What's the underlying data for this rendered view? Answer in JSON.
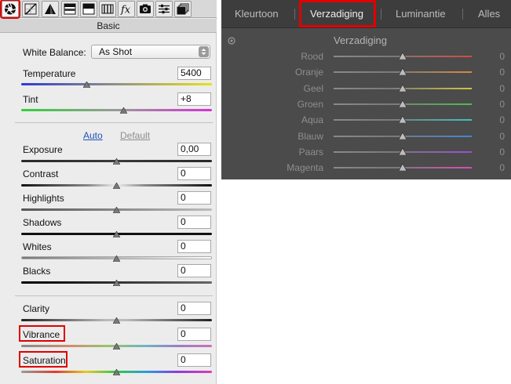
{
  "basic_panel": {
    "header": "Basic",
    "white_balance": {
      "label": "White Balance:",
      "value": "As Shot"
    },
    "temperature": {
      "label": "Temperature",
      "value": "5400"
    },
    "tint": {
      "label": "Tint",
      "value": "+8"
    },
    "auto_link": "Auto",
    "default_link": "Default",
    "sliders": [
      {
        "label": "Exposure",
        "value": "0,00"
      },
      {
        "label": "Contrast",
        "value": "0"
      },
      {
        "label": "Highlights",
        "value": "0"
      },
      {
        "label": "Shadows",
        "value": "0"
      },
      {
        "label": "Whites",
        "value": "0"
      },
      {
        "label": "Blacks",
        "value": "0"
      }
    ],
    "presence": [
      {
        "label": "Clarity",
        "value": "0"
      },
      {
        "label": "Vibrance",
        "value": "0"
      },
      {
        "label": "Saturation",
        "value": "0"
      }
    ],
    "toolbar_icons": [
      "basic-aperture-icon",
      "tone-curve-icon",
      "detail-triangle-icon",
      "hsl-grayscale-icon",
      "split-toning-icon",
      "lens-corrections-icon",
      "effects-fx-icon",
      "camera-calibration-icon",
      "presets-sliders-icon",
      "snapshots-icon"
    ],
    "highlight_color": "#e00000"
  },
  "hsl_panel": {
    "tabs": [
      "Kleurtoon",
      "Verzadiging",
      "Luminantie",
      "Alles"
    ],
    "active_tab": "Verzadiging",
    "section_title": "Verzadiging",
    "colors": [
      {
        "label": "Rood",
        "value": "0",
        "color": "#d64a3d"
      },
      {
        "label": "Oranje",
        "value": "0",
        "color": "#d68a3d"
      },
      {
        "label": "Geel",
        "value": "0",
        "color": "#d2c23d"
      },
      {
        "label": "Groen",
        "value": "0",
        "color": "#4fbf47"
      },
      {
        "label": "Aqua",
        "value": "0",
        "color": "#3fc1c4"
      },
      {
        "label": "Blauw",
        "value": "0",
        "color": "#3f87d6"
      },
      {
        "label": "Paars",
        "value": "0",
        "color": "#9a4fd6"
      },
      {
        "label": "Magenta",
        "value": "0",
        "color": "#d64fb4"
      }
    ]
  }
}
